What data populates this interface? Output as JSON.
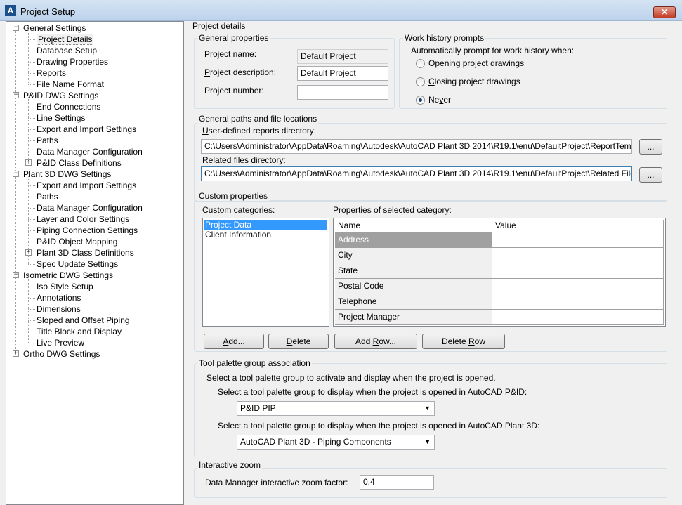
{
  "window": {
    "title": "Project Setup",
    "logo_glyph": "A",
    "close_glyph": "✕"
  },
  "tree": {
    "nodes": [
      {
        "label": "General Settings",
        "expander": "−"
      },
      {
        "label": "Project Details"
      },
      {
        "label": "Database Setup"
      },
      {
        "label": "Drawing Properties"
      },
      {
        "label": "Reports"
      },
      {
        "label": "File Name Format"
      },
      {
        "label": "P&ID DWG Settings",
        "expander": "−"
      },
      {
        "label": "End Connections"
      },
      {
        "label": "Line Settings"
      },
      {
        "label": "Export and Import Settings"
      },
      {
        "label": "Paths"
      },
      {
        "label": "Data Manager Configuration"
      },
      {
        "label": "P&ID Class Definitions",
        "expander": "+"
      },
      {
        "label": "Plant 3D DWG Settings",
        "expander": "−"
      },
      {
        "label": "Export and Import Settings"
      },
      {
        "label": "Paths"
      },
      {
        "label": "Data Manager Configuration"
      },
      {
        "label": "Layer and Color Settings"
      },
      {
        "label": "Piping Connection Settings"
      },
      {
        "label": "P&ID Object Mapping"
      },
      {
        "label": "Plant 3D Class Definitions",
        "expander": "+"
      },
      {
        "label": "Spec Update Settings"
      },
      {
        "label": "Isometric DWG Settings",
        "expander": "−"
      },
      {
        "label": "Iso Style Setup"
      },
      {
        "label": "Annotations"
      },
      {
        "label": "Dimensions"
      },
      {
        "label": "Sloped and Offset Piping"
      },
      {
        "label": "Title Block and Display"
      },
      {
        "label": "Live Preview"
      },
      {
        "label": "Ortho DWG Settings",
        "expander": "+"
      }
    ]
  },
  "details": {
    "heading": "Project details",
    "general": {
      "title": "General properties",
      "name_label": "Project name:",
      "name_value": "Default Project",
      "desc_label_u": "P",
      "desc_label_rest": "roject description:",
      "desc_value": "Default Project",
      "number_label": "Project number:",
      "number_value": ""
    },
    "work_history": {
      "title": "Work history prompts",
      "prompt": "Automatically prompt for work history when:",
      "opt1_pre": "Op",
      "opt1_u": "e",
      "opt1_post": "ning project drawings",
      "opt2_u": "C",
      "opt2_post": "losing project drawings",
      "opt3_pre": "Ne",
      "opt3_u": "v",
      "opt3_post": "er",
      "selected": "Never"
    },
    "paths": {
      "title": "General paths and file locations",
      "reports_label_u": "U",
      "reports_label_rest": "ser-defined reports directory:",
      "reports_value": "C:\\Users\\Administrator\\AppData\\Roaming\\Autodesk\\AutoCAD Plant 3D 2014\\R19.1\\enu\\DefaultProject\\ReportTemplates",
      "related_label_pre": "Related ",
      "related_label_u": "f",
      "related_label_post": "iles directory:",
      "related_value": "C:\\Users\\Administrator\\AppData\\Roaming\\Autodesk\\AutoCAD Plant 3D 2014\\R19.1\\enu\\DefaultProject\\Related Files",
      "browse_label": "..."
    },
    "custom": {
      "title": "Custom properties",
      "categories_label_u": "C",
      "categories_label_rest": "ustom categories:",
      "categories": [
        "Project Data",
        "Client Information"
      ],
      "selected_category": "Project Data",
      "props_label_pre": "P",
      "props_label_u": "r",
      "props_label_post": "operties of selected category:",
      "columns": [
        "Name",
        "Value"
      ],
      "rows": [
        {
          "name": "Address",
          "value": ""
        },
        {
          "name": "City",
          "value": ""
        },
        {
          "name": "State",
          "value": ""
        },
        {
          "name": "Postal Code",
          "value": ""
        },
        {
          "name": "Telephone",
          "value": ""
        },
        {
          "name": "Project Manager",
          "value": ""
        }
      ],
      "add_u": "A",
      "add_rest": "dd...",
      "delete_u": "D",
      "delete_rest": "elete",
      "add_row_pre": "Add ",
      "add_row_u": "R",
      "add_row_post": "ow...",
      "delete_row_pre": "Delete ",
      "delete_row_u": "R",
      "delete_row_post": "ow"
    },
    "tool_palette": {
      "title": "Tool palette group association",
      "intro": "Select a tool palette group to activate and display when the project is opened.",
      "pid_label": "Select a tool palette group to display when the project is opened in AutoCAD P&ID:",
      "pid_value": "P&ID PIP",
      "plant_label": "Select a tool palette group to display when the project is opened in AutoCAD Plant 3D:",
      "plant_value": "AutoCAD Plant 3D - Piping Components"
    },
    "zoom": {
      "title": "Interactive zoom",
      "label": "Data Manager interactive zoom factor:",
      "value": "0.4"
    }
  }
}
